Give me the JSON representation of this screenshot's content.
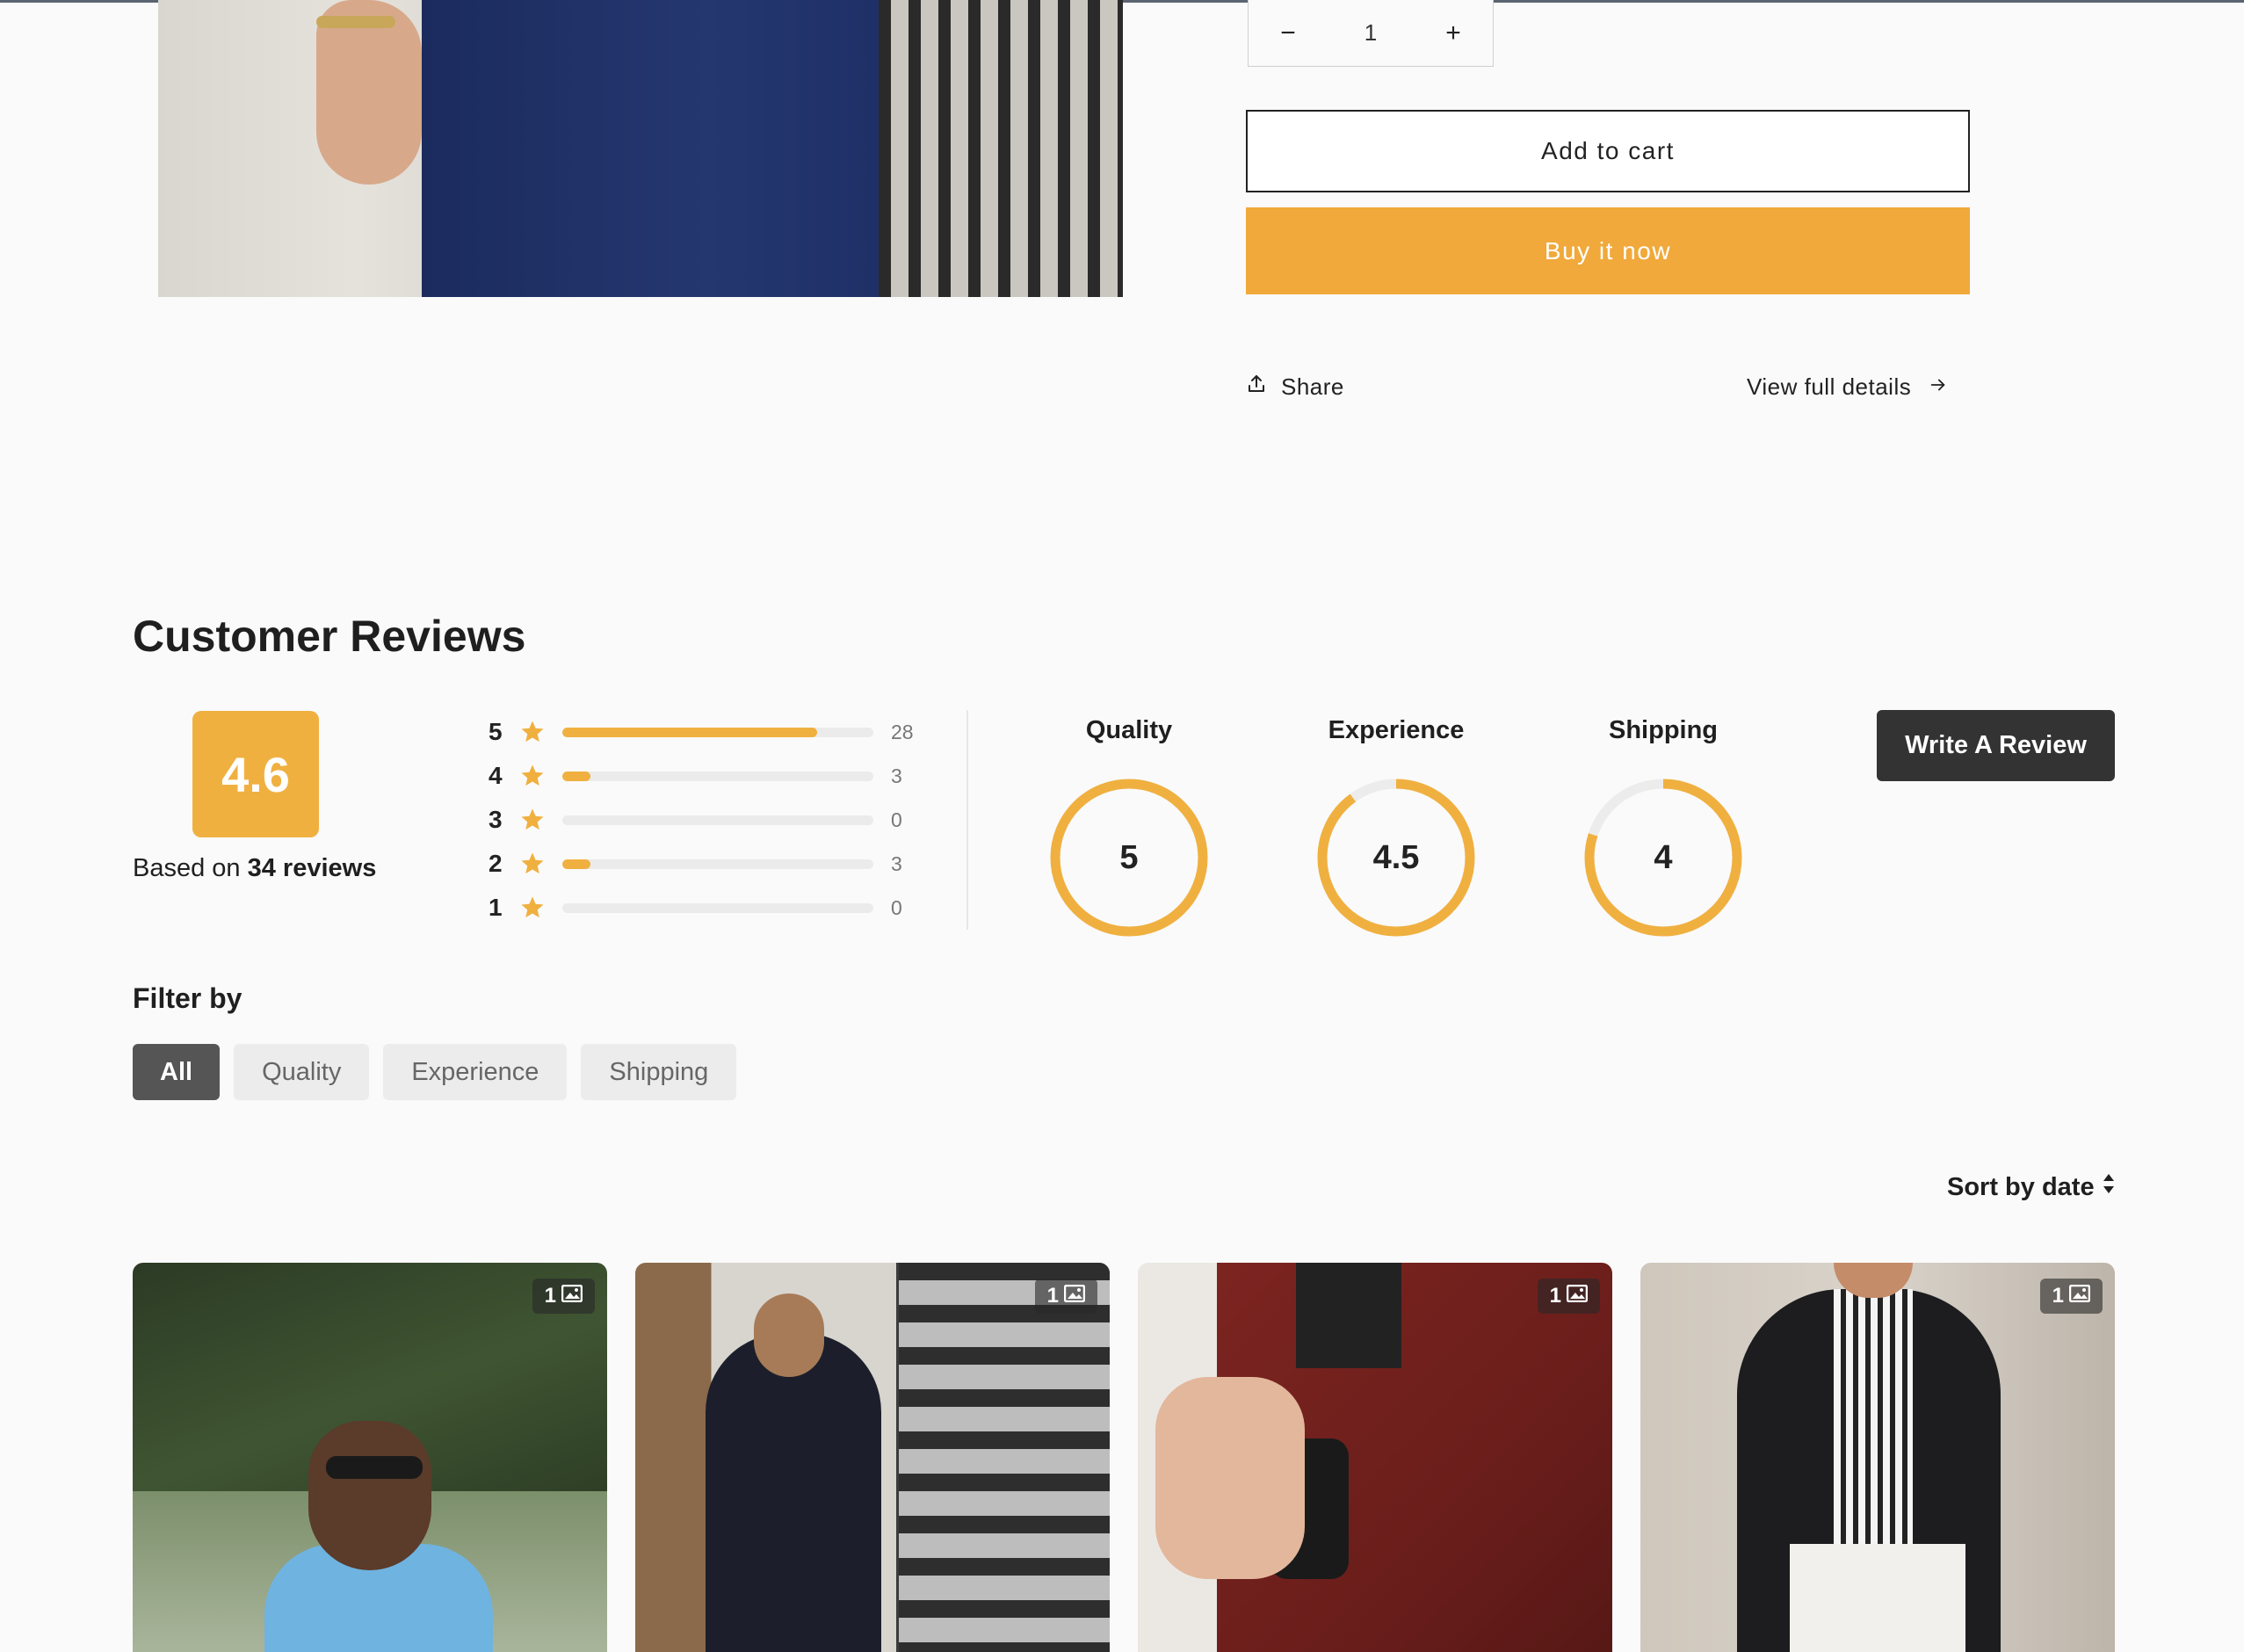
{
  "product": {
    "quantity": "1",
    "qty_minus": "−",
    "qty_plus": "+",
    "add_to_cart": "Add to cart",
    "buy_now": "Buy it now",
    "share": "Share",
    "view_full_details": "View full details"
  },
  "reviews": {
    "title": "Customer Reviews",
    "average": "4.6",
    "based_on_prefix": "Based on",
    "based_on_count": "34 reviews",
    "distribution": [
      {
        "stars": "5",
        "count": "28",
        "fraction": 0.82
      },
      {
        "stars": "4",
        "count": "3",
        "fraction": 0.09
      },
      {
        "stars": "3",
        "count": "0",
        "fraction": 0
      },
      {
        "stars": "2",
        "count": "3",
        "fraction": 0.09
      },
      {
        "stars": "1",
        "count": "0",
        "fraction": 0
      }
    ],
    "metrics": [
      {
        "label": "Quality",
        "value": "5",
        "fraction": 1.0
      },
      {
        "label": "Experience",
        "value": "4.5",
        "fraction": 0.9
      },
      {
        "label": "Shipping",
        "value": "4",
        "fraction": 0.8
      }
    ],
    "write_review": "Write A Review",
    "filter_title": "Filter by",
    "filters": [
      "All",
      "Quality",
      "Experience",
      "Shipping"
    ],
    "active_filter": "All",
    "sort_label": "Sort by date",
    "cards": [
      {
        "image_count": "1"
      },
      {
        "image_count": "1"
      },
      {
        "image_count": "1"
      },
      {
        "image_count": "1"
      }
    ]
  },
  "colors": {
    "accent": "#f0b040",
    "buy_now": "#f0a93a",
    "dark_button": "#333333",
    "ring_track": "#ececec"
  }
}
